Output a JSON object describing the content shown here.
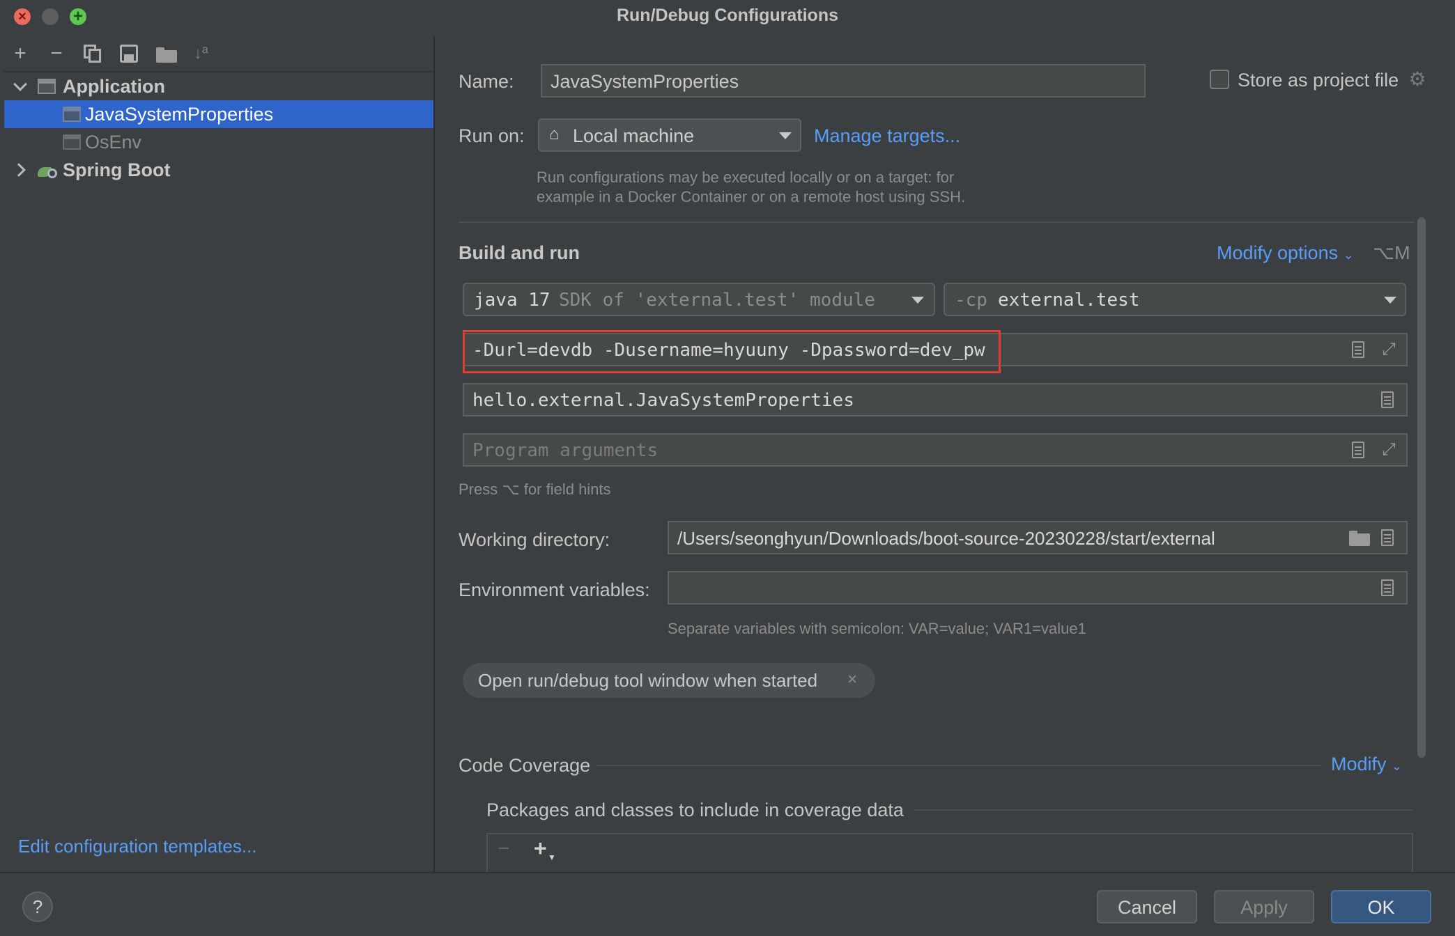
{
  "window": {
    "title": "Run/Debug Configurations"
  },
  "toolbar": {
    "add": "+",
    "remove": "−",
    "copy": "copy",
    "save": "save",
    "folder": "new-folder",
    "sort": "sort"
  },
  "tree": {
    "application": {
      "label": "Application"
    },
    "items": [
      {
        "label": "JavaSystemProperties",
        "selected": true
      },
      {
        "label": "OsEnv",
        "selected": false
      }
    ],
    "spring_boot": {
      "label": "Spring Boot"
    }
  },
  "edit_templates": "Edit configuration templates...",
  "form": {
    "name_label": "Name:",
    "name_value": "JavaSystemProperties",
    "store_label": "Store as project file",
    "run_on_label": "Run on:",
    "run_on_value": "Local machine",
    "manage_targets": "Manage targets...",
    "run_on_hint_1": "Run configurations may be executed locally or on a target: for",
    "run_on_hint_2": "example in a Docker Container or on a remote host using SSH.",
    "build_run_title": "Build and run",
    "modify_options": "Modify options",
    "modify_shortcut": "⌥M",
    "jdk_main": "java 17",
    "jdk_detail": "SDK of 'external.test' module",
    "cp_prefix": "-cp",
    "cp_value": "external.test",
    "vm_options": "-Durl=devdb -Dusername=hyuuny -Dpassword=dev_pw",
    "main_class": "hello.external.JavaSystemProperties",
    "program_args_placeholder": "Program arguments",
    "field_hint": "Press ⌥ for field hints",
    "working_dir_label": "Working directory:",
    "working_dir_value": "/Users/seonghyun/Downloads/boot-source-20230228/start/external",
    "env_label": "Environment variables:",
    "env_value": "",
    "env_hint": "Separate variables with semicolon: VAR=value; VAR1=value1",
    "chip_label": "Open run/debug tool window when started",
    "code_coverage_title": "Code Coverage",
    "modify": "Modify",
    "packages_label": "Packages and classes to include in coverage data"
  },
  "buttons": {
    "cancel": "Cancel",
    "apply": "Apply",
    "ok": "OK",
    "help": "?"
  },
  "colors": {
    "accent": "#589df6",
    "selection": "#2f65ca",
    "highlight_border": "#e0402e"
  }
}
